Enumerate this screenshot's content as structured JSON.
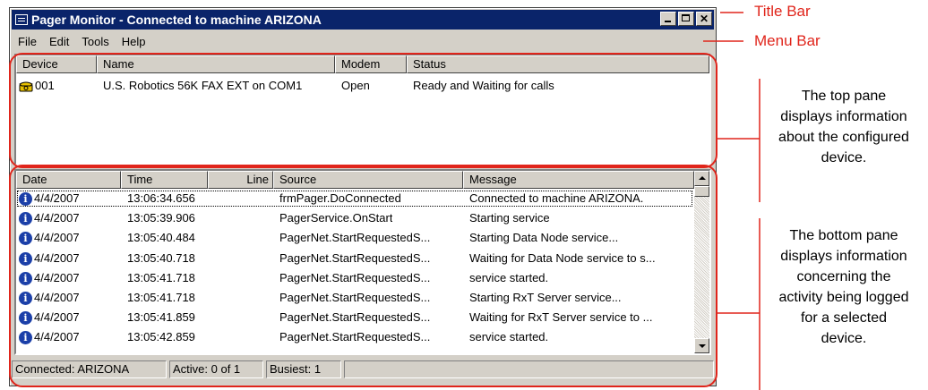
{
  "window": {
    "title": "Pager Monitor - Connected to machine ARIZONA",
    "icons": {
      "app": "pager-app-icon",
      "minimize": "minimize-icon",
      "maximize": "maximize-icon",
      "close": "close-icon"
    }
  },
  "menu": [
    "File",
    "Edit",
    "Tools",
    "Help"
  ],
  "top_pane": {
    "columns": [
      "Device",
      "Name",
      "Modem",
      "Status"
    ],
    "rows": [
      {
        "icon": "phone-icon",
        "device": "001",
        "name": "U.S. Robotics 56K FAX EXT on COM1",
        "modem": "Open",
        "status": "Ready and Waiting for calls"
      }
    ]
  },
  "bottom_pane": {
    "columns": [
      "Date",
      "Time",
      "Line",
      "Source",
      "Message"
    ],
    "rows": [
      {
        "icon": "info-icon",
        "date": "4/4/2007",
        "time": "13:06:34.656",
        "line": "",
        "source": "frmPager.DoConnected",
        "message": "Connected to machine ARIZONA."
      },
      {
        "icon": "info-icon",
        "date": "4/4/2007",
        "time": "13:05:39.906",
        "line": "",
        "source": "PagerService.OnStart",
        "message": "Starting service"
      },
      {
        "icon": "info-icon",
        "date": "4/4/2007",
        "time": "13:05:40.484",
        "line": "",
        "source": "PagerNet.StartRequestedS...",
        "message": "Starting Data Node service..."
      },
      {
        "icon": "info-icon",
        "date": "4/4/2007",
        "time": "13:05:40.718",
        "line": "",
        "source": "PagerNet.StartRequestedS...",
        "message": "Waiting for Data Node service to s..."
      },
      {
        "icon": "info-icon",
        "date": "4/4/2007",
        "time": "13:05:41.718",
        "line": "",
        "source": "PagerNet.StartRequestedS...",
        "message": "service started."
      },
      {
        "icon": "info-icon",
        "date": "4/4/2007",
        "time": "13:05:41.718",
        "line": "",
        "source": "PagerNet.StartRequestedS...",
        "message": "Starting RxT Server service..."
      },
      {
        "icon": "info-icon",
        "date": "4/4/2007",
        "time": "13:05:41.859",
        "line": "",
        "source": "PagerNet.StartRequestedS...",
        "message": "Waiting for RxT Server service to ..."
      },
      {
        "icon": "info-icon",
        "date": "4/4/2007",
        "time": "13:05:42.859",
        "line": "",
        "source": "PagerNet.StartRequestedS...",
        "message": "service started."
      }
    ]
  },
  "status_bar": [
    "Connected: ARIZONA",
    "Active: 0 of 1",
    "Busiest: 1"
  ],
  "annotations": {
    "title_bar": "Title Bar",
    "menu_bar": "Menu Bar",
    "top_pane_note": [
      "The top pane",
      "displays information",
      "about the configured",
      "device."
    ],
    "bottom_pane_note": [
      "The bottom pane",
      "displays information",
      "concerning the",
      "activity being logged",
      "for a selected",
      "device."
    ]
  },
  "colors": {
    "annotation_red": "#e0251b",
    "titlebar": "#0a246a",
    "info_icon": "#1b3fa8"
  }
}
